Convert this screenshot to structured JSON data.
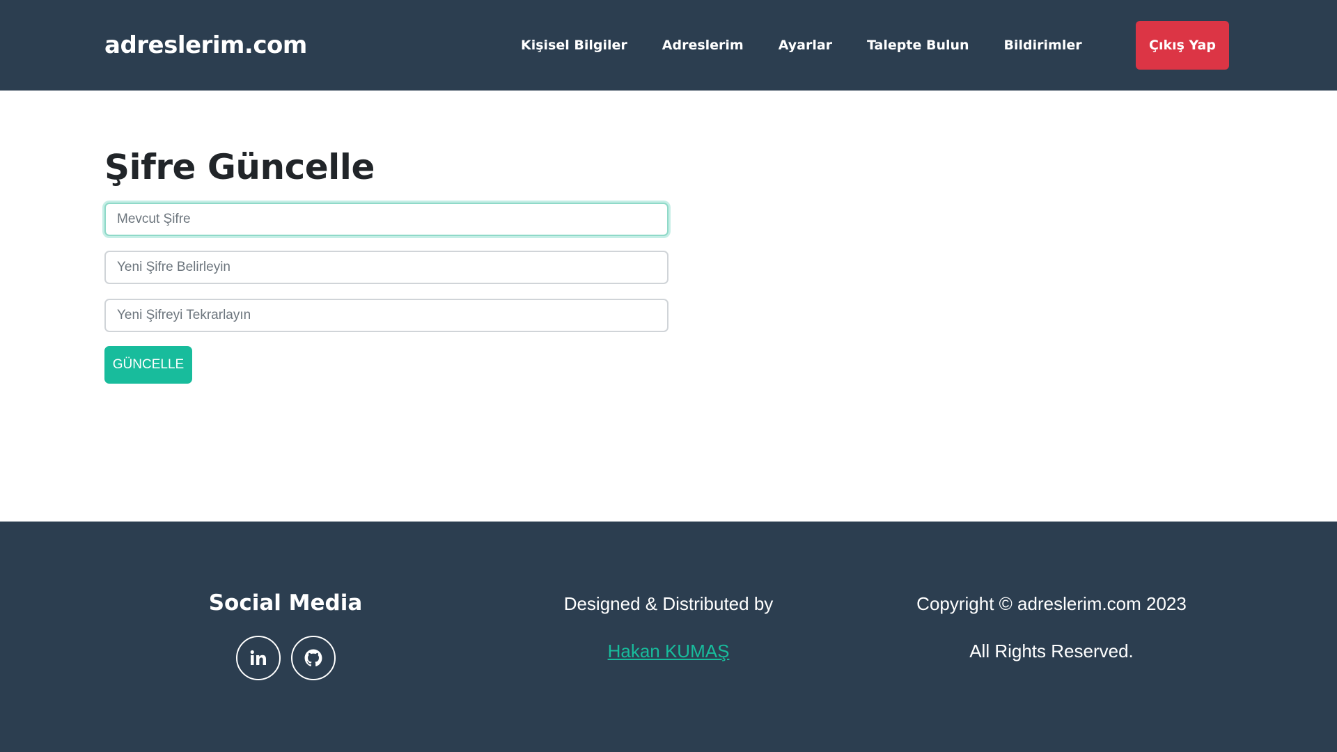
{
  "navbar": {
    "brand": "adreslerim.com",
    "links": [
      {
        "label": "Kişisel Bilgiler"
      },
      {
        "label": "Adreslerim"
      },
      {
        "label": "Ayarlar"
      },
      {
        "label": "Talepte Bulun"
      },
      {
        "label": "Bildirimler"
      }
    ],
    "logout_label": "Çıkış Yap",
    "logout_color": "#dc3545",
    "background": "#2c3e50"
  },
  "form": {
    "title": "Şifre Güncelle",
    "current_password": {
      "placeholder": "Mevcut Şifre",
      "value": ""
    },
    "new_password": {
      "placeholder": "Yeni Şifre Belirleyin",
      "value": ""
    },
    "repeat_password": {
      "placeholder": "Yeni Şifreyi Tekrarlayın",
      "value": ""
    },
    "submit_label": "GÜNCELLE",
    "accent_color": "#18bc9c"
  },
  "footer": {
    "social": {
      "title": "Social Media",
      "icons": [
        "linkedin-icon",
        "github-icon"
      ]
    },
    "designed_by": {
      "text": "Designed & Distributed by",
      "author": "Hakan KUMAŞ"
    },
    "copyright": {
      "text": "Copyright © adreslerim.com 2023",
      "rights": "All Rights Reserved."
    }
  }
}
